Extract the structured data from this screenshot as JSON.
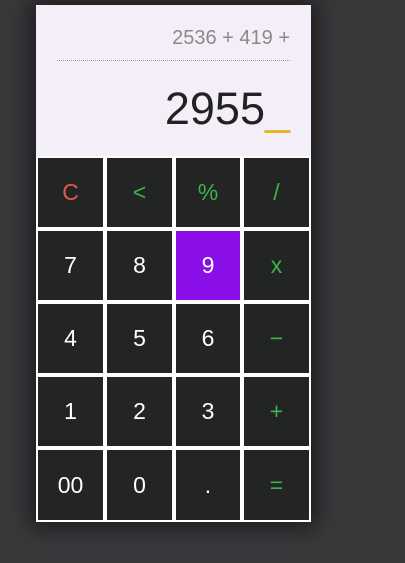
{
  "display": {
    "expression": "2536 + 419 +",
    "result": "2955",
    "cursor": "_"
  },
  "colors": {
    "display_bg": "#f3eef7",
    "key_bg": "#222523",
    "key_text": "#ffffff",
    "operator_text": "#3fb24a",
    "clear_text": "#e0594a",
    "active_key_bg": "#8a0ee8",
    "cursor": "#e6b422"
  },
  "keys": {
    "clear": "C",
    "backspace": "<",
    "percent": "%",
    "divide": "/",
    "seven": "7",
    "eight": "8",
    "nine": "9",
    "multiply": "x",
    "four": "4",
    "five": "5",
    "six": "6",
    "subtract": "−",
    "one": "1",
    "two": "2",
    "three": "3",
    "add": "+",
    "double_zero": "00",
    "zero": "0",
    "decimal": ".",
    "equals": "="
  }
}
